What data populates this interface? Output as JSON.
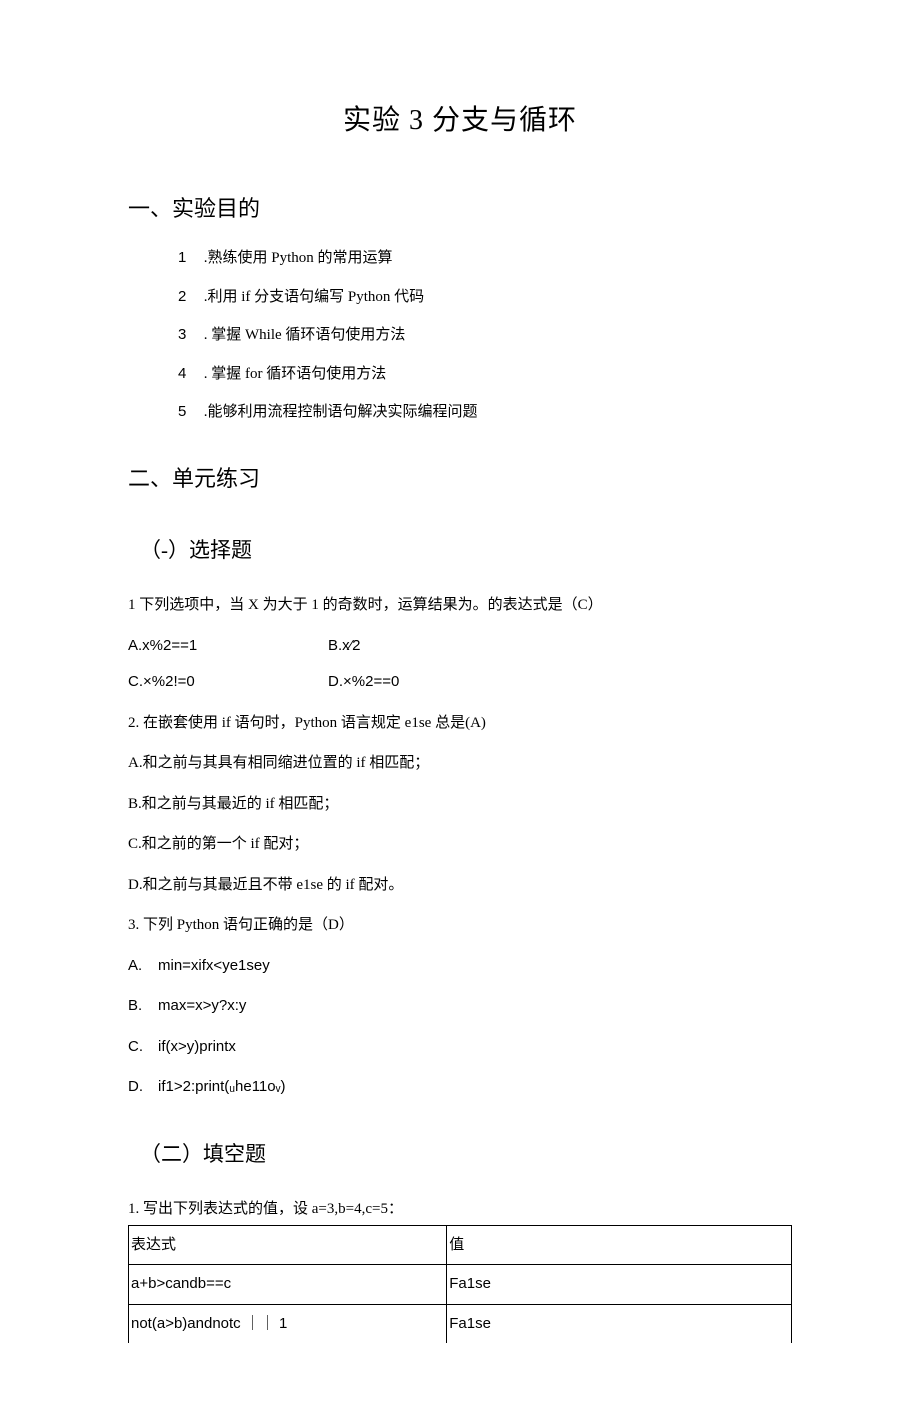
{
  "title": "实验 3 分支与循环",
  "section1": {
    "heading": "一、实验目的",
    "items": [
      {
        "num": "1",
        "text": " .熟练使用 Python 的常用运算"
      },
      {
        "num": "2",
        "text": " .利用 if 分支语句编写 Python 代码"
      },
      {
        "num": "3",
        "text": " . 掌握 While 循环语句使用方法"
      },
      {
        "num": "4",
        "text": " . 掌握 for 循环语句使用方法"
      },
      {
        "num": "5",
        "text": " .能够利用流程控制语句解决实际编程问题"
      }
    ]
  },
  "section2": {
    "heading": "二、单元练习",
    "sub1": {
      "heading": "（-）选择题",
      "q1": {
        "stem": "1 下列选项中，当 X 为大于 1 的奇数时，运算结果为。的表达式是（C）",
        "row1a": "A.x%2==1",
        "row1b": "B.x⁄2",
        "row2a": "C.×%2!=0",
        "row2b": "D.×%2==0"
      },
      "q2": {
        "stem": "2. 在嵌套使用 if 语句时，Python 语言规定 e1se 总是(A)",
        "a": "A.和之前与其具有相同缩进位置的 if 相匹配；",
        "b": "B.和之前与其最近的 if 相匹配；",
        "c": "C.和之前的第一个 if 配对；",
        "d": "D.和之前与其最近且不带 e1se 的 if 配对。"
      },
      "q3": {
        "stem": "3. 下列 Python 语句正确的是（D）",
        "a": {
          "letter": "A.",
          "text": "min=xifx<ye1sey"
        },
        "b": {
          "letter": "B.",
          "text": "max=x>y?x:y"
        },
        "c": {
          "letter": "C.",
          "text": "if(x>y)printx"
        },
        "d": {
          "letter": "D.",
          "text": "if1>2:print(ᵤhe11oᵥ)"
        }
      }
    },
    "sub2": {
      "heading": "（二）填空题",
      "q1": {
        "stem": "1. 写出下列表达式的值，设 a=3,b=4,c=5：",
        "table": {
          "h1": "表达式",
          "h2": "值",
          "r1c1": "a+b>candb==c",
          "r1c2": "Fa1se",
          "r2c1": "not(a>b)andnotc ｜｜ 1",
          "r2c2": "Fa1se"
        }
      }
    }
  }
}
